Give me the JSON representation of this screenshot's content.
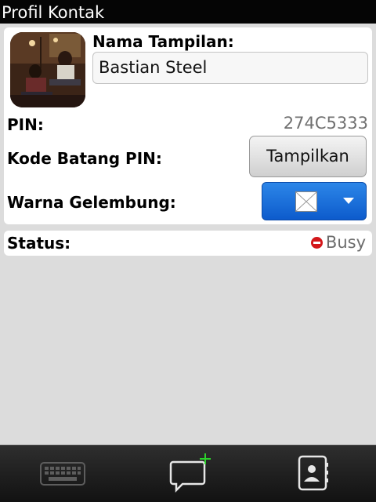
{
  "titlebar": {
    "title": "Profil Kontak"
  },
  "profile": {
    "display_name_label": "Nama Tampilan:",
    "display_name_value": "Bastian Steel",
    "pin_label": "PIN:",
    "pin_value": "274C5333",
    "barcode_label": "Kode Batang PIN:",
    "show_button_label": "Tampilkan",
    "bubble_color_label": "Warna Gelembung:",
    "bubble_color_selected": "#1a6fdc"
  },
  "status": {
    "label": "Status:",
    "value": "Busy",
    "indicator_color": "#d3171a"
  },
  "bottombar": {
    "icons": [
      "keyboard-icon",
      "new-chat-icon",
      "contact-card-icon"
    ]
  }
}
